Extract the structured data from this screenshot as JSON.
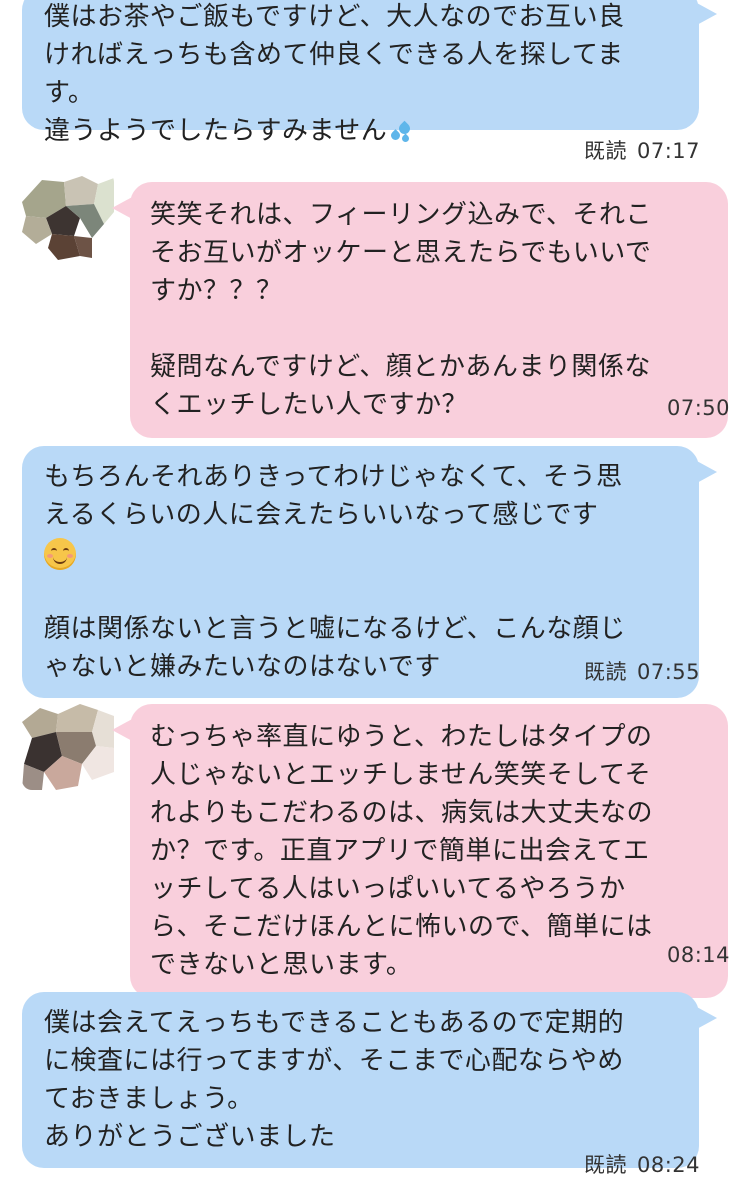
{
  "messages": [
    {
      "lines": [
        "僕はお茶やご飯もですけど、大人なのでお互い良",
        "ければえっちも含めて仲良くできる人を探してま",
        "す。",
        "違うようでしたらすみません"
      ],
      "emoji": "sweat-droplets-icon",
      "read_label": "既読",
      "time": "07:17"
    },
    {
      "paragraphs": [
        "笑笑それは、フィーリング込みで、それこ\nそお互いがオッケーと思えたらでもいいで\nすか？？？",
        "疑問なんですけど、顔とかあんまり関係な\nくエッチしたい人ですか？"
      ],
      "time": "07:50"
    },
    {
      "paragraphs": [
        "もちろんそれありきってわけじゃなくて、そう思\nえるくらいの人に会えたらいいなって感じです",
        "顔は関係ないと言うと嘘になるけど、こんな顔じ\nゃないと嫌みたいなのはないです"
      ],
      "emoji": "smiling-face-icon",
      "read_label": "既読",
      "time": "07:55"
    },
    {
      "text": "むっちゃ率直にゆうと、わたしはタイプの\n人じゃないとエッチしません笑笑そしてそ\nれよりもこだわるのは、病気は大丈夫なの\nか？です。正直アプリで簡単に出会えてエ\nッチしてる人はいっぱいいてるやろうか\nら、そこだけほんとに怖いので、簡単には\nできないと思います。",
      "time": "08:14"
    },
    {
      "text": "僕は会えてえっちもできることもあるので定期的\nに検査には行ってますが、そこまで心配ならやめ\nておきましょう。\nありがとうございました",
      "read_label": "既読",
      "time": "08:24"
    }
  ],
  "colors": {
    "sent_bubble": "#b9d9f7",
    "received_bubble": "#f9cfdc"
  }
}
